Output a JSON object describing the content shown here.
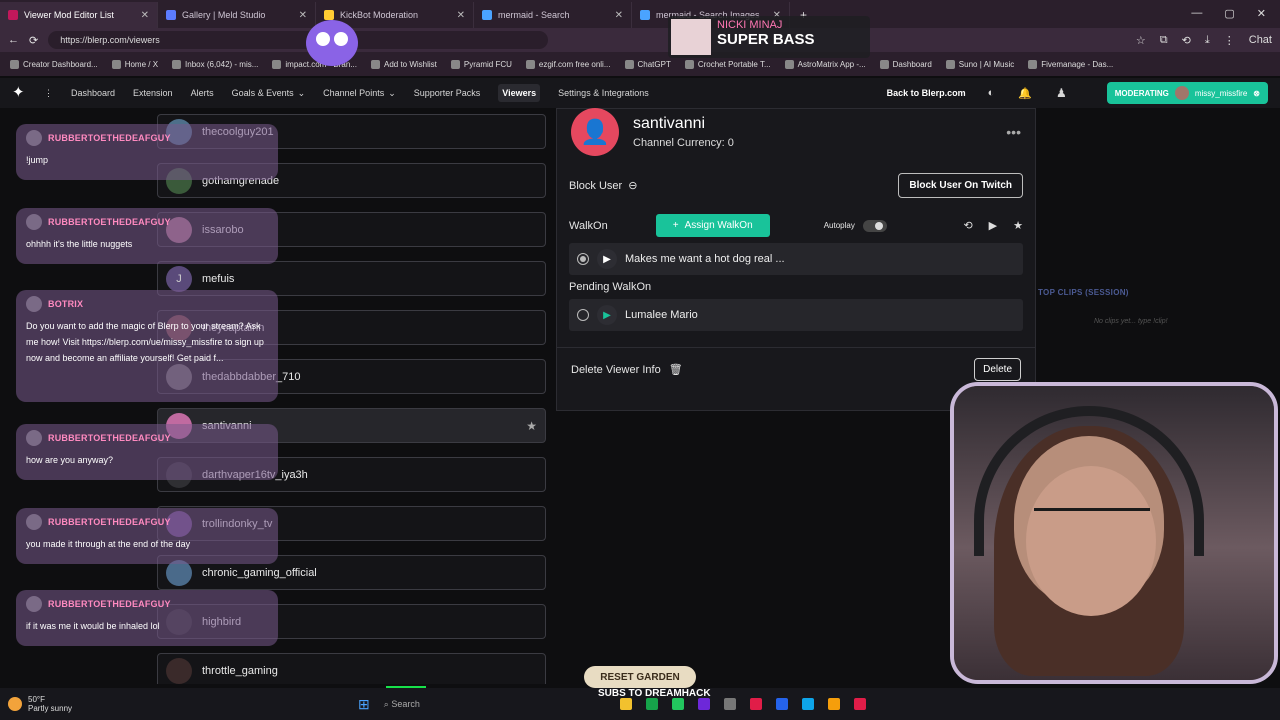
{
  "browser": {
    "tabs": [
      {
        "label": "Viewer Mod Editor List",
        "active": true
      },
      {
        "label": "Gallery | Meld Studio"
      },
      {
        "label": "KickBot Moderation"
      },
      {
        "label": "mermaid - Search"
      },
      {
        "label": "mermaid - Search Images"
      }
    ],
    "url": "https://blerp.com/viewers",
    "bookmarks": [
      "Creator Dashboard...",
      "Home / X",
      "Inbox (6,042) - mis...",
      "impact.com - Bran...",
      "Add to Wishlist",
      "Pyramid FCU",
      "ezgif.com free onli...",
      "ChatGPT",
      "Crochet Portable T...",
      "AstroMatrix App -...",
      "Dashboard",
      "Suno | AI Music",
      "Fivemanage - Das..."
    ],
    "chat_label": "Chat"
  },
  "nav": {
    "items": [
      "Dashboard",
      "Extension",
      "Alerts",
      "Goals & Events",
      "Channel Points",
      "Supporter Packs",
      "Viewers",
      "Settings & Integrations"
    ],
    "back_label": "Back to Blerp.com",
    "moderating_label": "MODERATING",
    "moderating_user": "missy_missfire"
  },
  "viewers": [
    {
      "name": "thecoolguy201"
    },
    {
      "name": "gothamgrenade"
    },
    {
      "name": "issarobo"
    },
    {
      "name": "mefuis",
      "initial": "J"
    },
    {
      "name": "theycaptainn"
    },
    {
      "name": "thedabbdabber_710"
    },
    {
      "name": "santivanni",
      "highlighted": true
    },
    {
      "name": "darthvaper16tv_iya3h"
    },
    {
      "name": "trollindonky_tv"
    },
    {
      "name": "chronic_gaming_official"
    },
    {
      "name": "highbird"
    },
    {
      "name": "throttle_gaming"
    }
  ],
  "chat": [
    {
      "user": "RUBBERTOETHEDEAFGUY",
      "text": "!jump"
    },
    {
      "user": "RUBBERTOETHEDEAFGUY",
      "text": "ohhhh it's the little nuggets"
    },
    {
      "user": "BOTRIX",
      "text": "Do you want to add the magic of Blerp to your stream? Ask me how! Visit https://blerp.com/ue/missy_missfire to sign up now and become an affiliate yourself! Get paid f..."
    },
    {
      "user": "RUBBERTOETHEDEAFGUY",
      "text": "how are you anyway?"
    },
    {
      "user": "RUBBERTOETHEDEAFGUY",
      "text": "you made it through at the end of the day"
    },
    {
      "user": "RUBBERTOETHEDEAFGUY",
      "text": "if it was me it would be inhaled lol"
    }
  ],
  "detail": {
    "username": "santivanni",
    "currency_label": "Channel Currency: 0",
    "block_user_label": "Block User",
    "block_twitch_label": "Block User On Twitch",
    "walkon_label": "WalkOn",
    "assign_label": "Assign WalkOn",
    "autoplay_label": "Autoplay",
    "walkon_clip": "Makes me want a hot dog real ...",
    "pending_label": "Pending WalkOn",
    "pending_clip": "Lumalee Mario",
    "delete_info_label": "Delete Viewer Info",
    "delete_label": "Delete"
  },
  "overlay": {
    "top_clips_label": "TOP CLIPS (SESSION)",
    "no_clips_label": "No clips yet... type !clip!",
    "song_artist": "NICKI MINAJ",
    "song_title": "SUPER BASS",
    "reset_label": "RESET GARDEN",
    "dreamhack_label": "SUBS TO DREAMHACK"
  },
  "taskbar": {
    "temp": "50°F",
    "condition": "Partly sunny",
    "search_label": "Search"
  },
  "colors": {
    "accent": "#19c39a",
    "chat_user": "#ff8ac0",
    "avatar": "#e5485f"
  }
}
